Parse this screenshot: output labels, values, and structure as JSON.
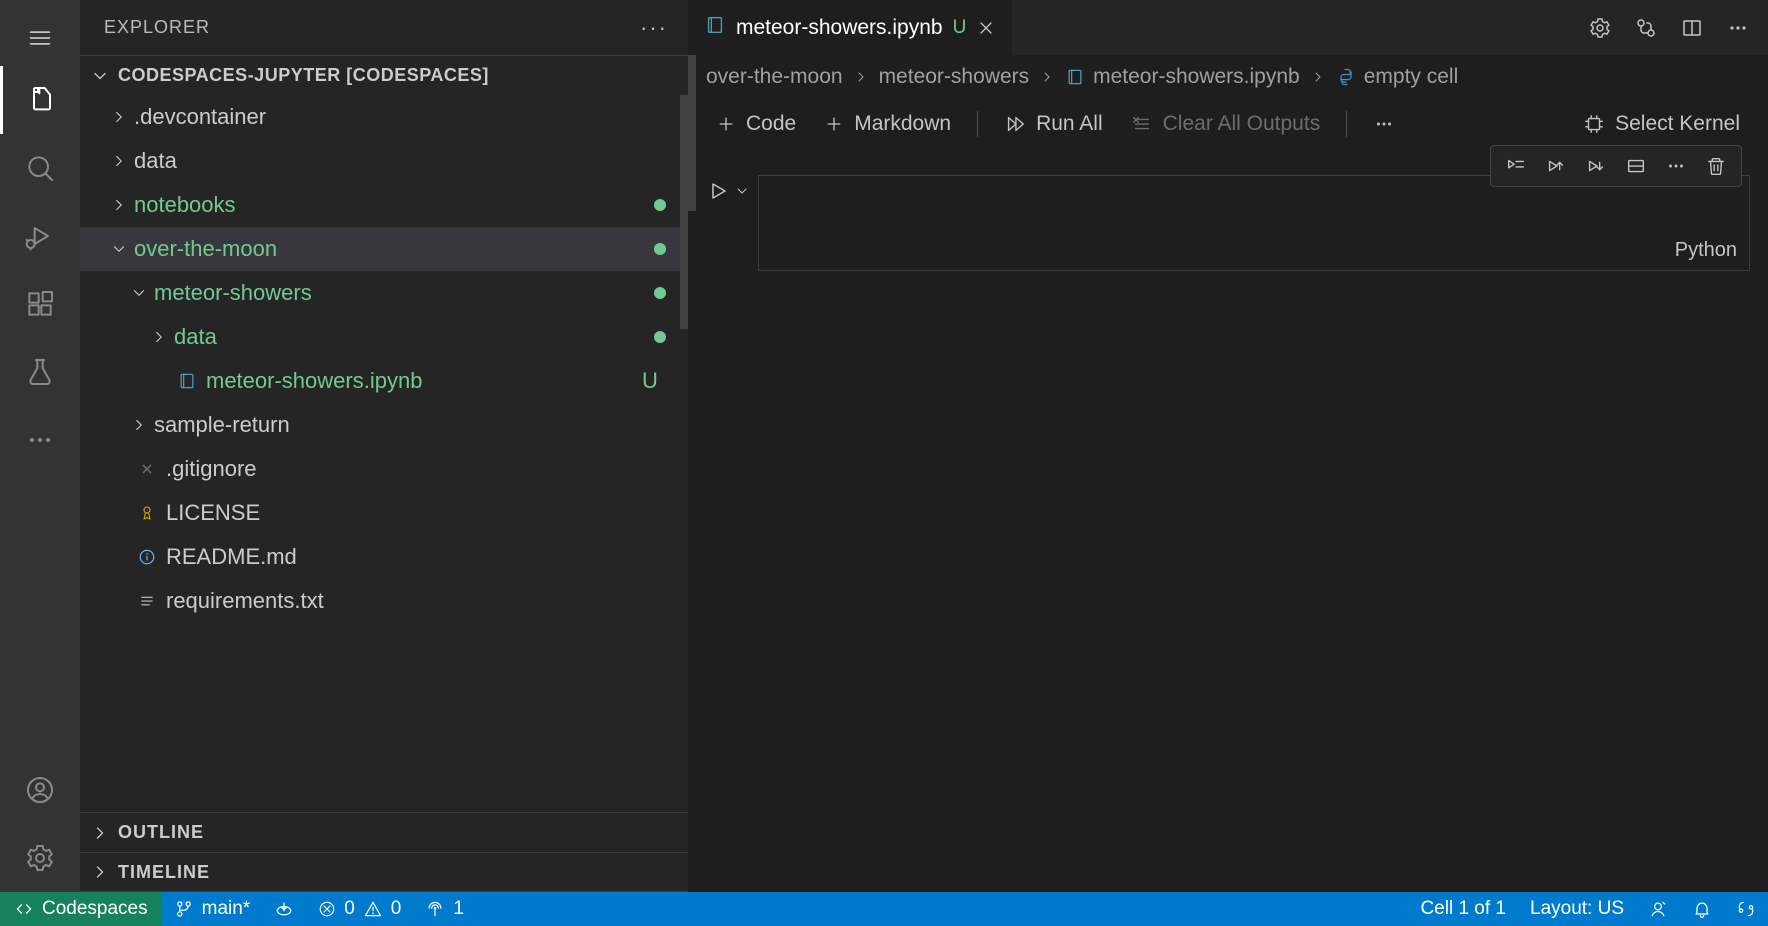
{
  "sidebar": {
    "title": "EXPLORER",
    "root": "CODESPACES-JUPYTER [CODESPACES]",
    "outline": "OUTLINE",
    "timeline": "TIMELINE",
    "items": [
      {
        "label": ".devcontainer"
      },
      {
        "label": "data"
      },
      {
        "label": "notebooks"
      },
      {
        "label": "over-the-moon"
      },
      {
        "label": "meteor-showers"
      },
      {
        "label": "data"
      },
      {
        "label": "meteor-showers.ipynb",
        "badge": "U"
      },
      {
        "label": "sample-return"
      },
      {
        "label": ".gitignore"
      },
      {
        "label": "LICENSE"
      },
      {
        "label": "README.md"
      },
      {
        "label": "requirements.txt"
      }
    ]
  },
  "tab": {
    "label": "meteor-showers.ipynb",
    "badge": "U"
  },
  "breadcrumbs": {
    "p1": "over-the-moon",
    "p2": "meteor-showers",
    "p3": "meteor-showers.ipynb",
    "p4": "empty cell"
  },
  "toolbar": {
    "code": "Code",
    "markdown": "Markdown",
    "runall": "Run All",
    "clear": "Clear All Outputs",
    "kernel": "Select Kernel"
  },
  "cell": {
    "lang": "Python"
  },
  "status": {
    "remote": "Codespaces",
    "branch": "main*",
    "errors": "0",
    "warnings": "0",
    "ports": "1",
    "cell": "Cell 1 of 1",
    "layout": "Layout: US"
  }
}
